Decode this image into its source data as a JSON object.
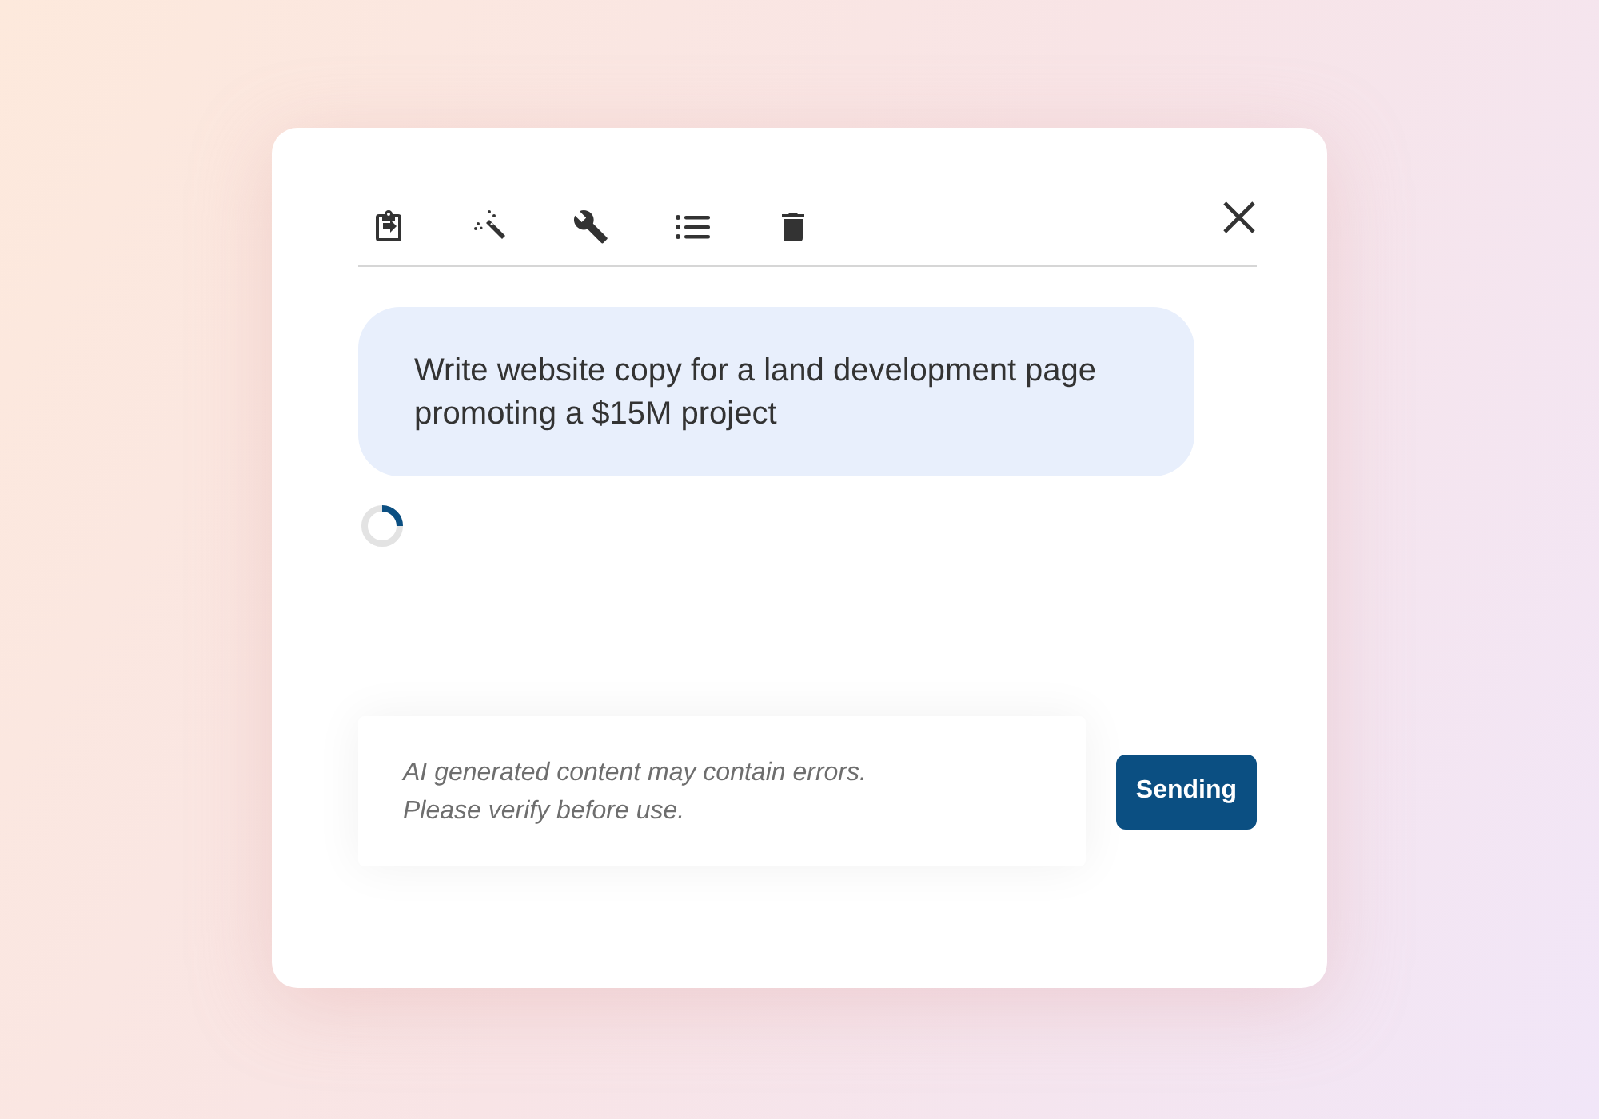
{
  "toolbar": {
    "tools": [
      {
        "kind": "clipboard"
      },
      {
        "kind": "wand"
      },
      {
        "kind": "wrench"
      },
      {
        "kind": "list"
      },
      {
        "kind": "trash"
      }
    ]
  },
  "messages": [
    {
      "text": "Write website copy for a land development page promoting a $15M project"
    }
  ],
  "loading": true,
  "composer": {
    "placeholder": "AI generated content may contain errors.\nPlease verify before use.",
    "send_label": "Sending"
  }
}
